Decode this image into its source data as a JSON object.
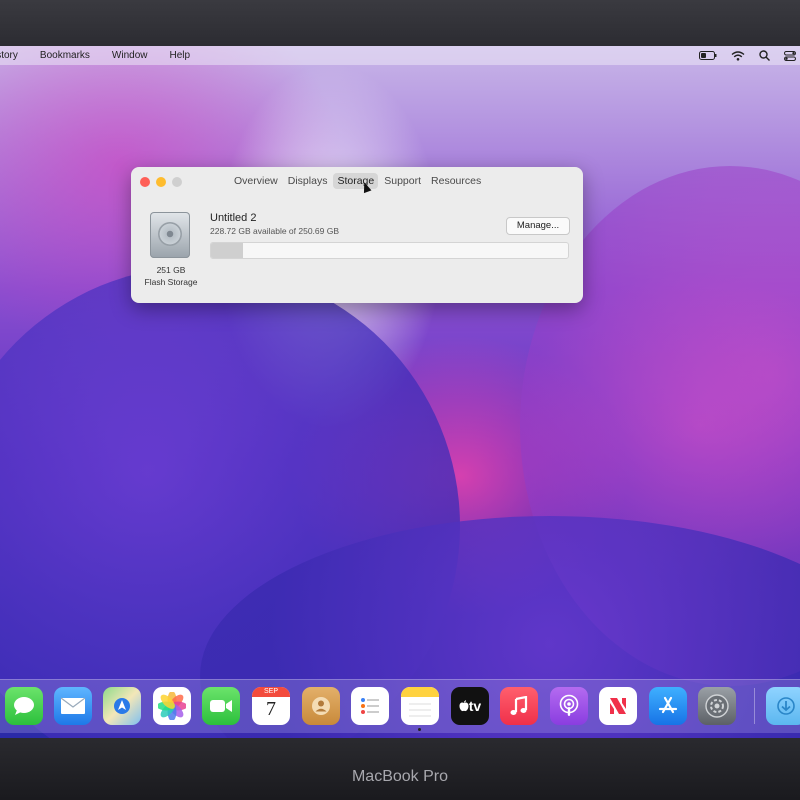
{
  "menubar": {
    "items": [
      "istory",
      "Bookmarks",
      "Window",
      "Help"
    ],
    "status_icons": [
      "battery-icon",
      "wifi-icon",
      "search-icon",
      "control-center-icon"
    ]
  },
  "window": {
    "tabs": [
      {
        "label": "Overview"
      },
      {
        "label": "Displays"
      },
      {
        "label": "Storage",
        "active": true
      },
      {
        "label": "Support"
      },
      {
        "label": "Resources"
      }
    ],
    "disk": {
      "size": "251 GB",
      "type": "Flash Storage"
    },
    "volume": {
      "name": "Untitled 2",
      "available": "228.72 GB available of 250.69 GB",
      "used_fraction": 0.09
    },
    "manage_label": "Manage..."
  },
  "dock": {
    "calendar_month": "SEP",
    "calendar_day": "7",
    "tv_label": "tv",
    "apps": [
      "messages",
      "mail",
      "maps",
      "photos",
      "facetime",
      "calendar",
      "contacts",
      "reminders",
      "notes",
      "apple-tv",
      "music",
      "podcasts",
      "news",
      "app-store",
      "system-preferences",
      "downloads"
    ]
  },
  "brand": "MacBook Pro",
  "colors": {
    "close": "#fe5f57",
    "minimize": "#febc2e"
  }
}
